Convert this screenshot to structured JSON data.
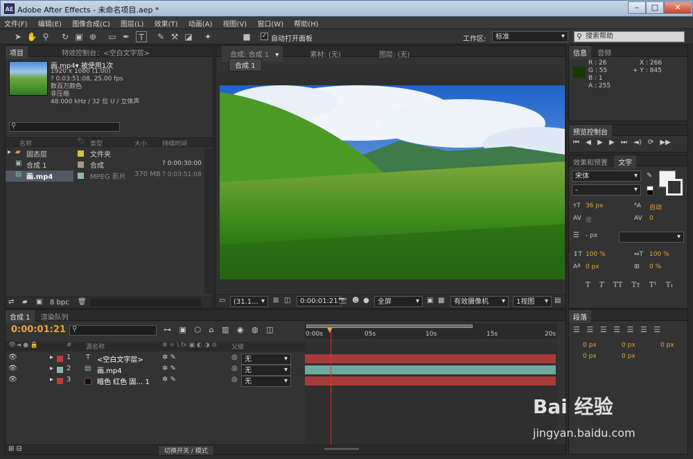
{
  "window": {
    "title": "Adobe After Effects - 未命名项目.aep *",
    "app_icon": "AE",
    "minimize": "–",
    "maximize": "□",
    "close": "✕"
  },
  "menu": [
    "文件(F)",
    "编辑(E)",
    "图像合成(C)",
    "图层(L)",
    "效果(T)",
    "动画(A)",
    "视图(V)",
    "窗口(W)",
    "帮助(H)"
  ],
  "toolbar": {
    "auto_open_label": "自动打开面板",
    "workspace_label": "工作区:",
    "workspace_value": "标准",
    "search_placeholder": "搜索帮助"
  },
  "project_panel": {
    "tab_project": "项目",
    "tab_effects": "特效控制台：<空白文字层>",
    "file_name": "画.mp4▾",
    "usage": "被使用1次",
    "info_lines": [
      "1920 x 1080 (1.00)",
      "? 0:03:51:08, 25.00 fps",
      "数百万颜色",
      "非压缩",
      "48.000 kHz / 32 位 U / 立体声"
    ],
    "columns": [
      "名称",
      "类型",
      "大小",
      "持续时间"
    ],
    "items": [
      {
        "name": "固态层",
        "type": "文件夹",
        "size": "",
        "duration": "",
        "color": "#d9c33a"
      },
      {
        "name": "合成 1",
        "type": "合成",
        "size": "",
        "duration": "? 0:00:30:00",
        "color": "#a89a7a"
      },
      {
        "name": "画.mp4",
        "type": "MPEG 影片",
        "size": "370 MB",
        "duration": "? 0:03:51:08",
        "color": "#8fb7b0"
      }
    ],
    "bpc": "8 bpc"
  },
  "comp_panel": {
    "tab_comp": "合成: 合成 1",
    "tab_footage": "素材: (无)",
    "tab_layer": "图层: (无)",
    "breadcrumb": "合成 1",
    "zoom": "(31.1...",
    "timecode": "0:00:01:21",
    "resolution": "全屏",
    "camera": "有效摄像机",
    "views": "1视图"
  },
  "info_panel": {
    "tab_info": "信息",
    "tab_audio": "音频",
    "r": "R : 26",
    "g": "G : 55",
    "b": "B : 1",
    "a": "A : 255",
    "x": "X : 266",
    "y": "+ Y : 845",
    "swatch": "#1a3701"
  },
  "preview_panel": {
    "tab": "预览控制台"
  },
  "char_panel": {
    "tab_effects": "效果和预置",
    "tab_text": "文字",
    "font": "宋体",
    "style": "-",
    "size": "36",
    "size_unit": "px",
    "leading": "自动",
    "kerning": "度",
    "tracking": "0",
    "stroke": "-",
    "stroke_unit": "px",
    "vscale": "100",
    "hscale": "100",
    "baseline": "0",
    "tsume": "0",
    "pct": "%",
    "px": "px",
    "styles": [
      "T",
      "T",
      "TT",
      "Tт",
      "T¹",
      "T₁"
    ]
  },
  "paragraph_panel": {
    "tab": "段落",
    "values": [
      "0",
      "0",
      "0",
      "0",
      "0"
    ],
    "unit": "px"
  },
  "timeline": {
    "tab_comp": "合成 1",
    "tab_render": "渲染队列",
    "timecode": "0:00:01:21",
    "col_num": "#",
    "col_name": "源名称",
    "col_parent": "父级",
    "ruler": [
      "0:00s",
      "05s",
      "10s",
      "15s",
      "20s"
    ],
    "layers": [
      {
        "num": "1",
        "name": "<空白文字层>",
        "color": "#c03a3a",
        "parent": "无",
        "bar": "#a83a3a"
      },
      {
        "num": "2",
        "name": "画.mp4",
        "color": "#8fb7b0",
        "parent": "无",
        "bar": "#6fa89f"
      },
      {
        "num": "3",
        "name": "暗色 红色 固… 1",
        "color": "#c03a3a",
        "parent": "无",
        "bar": "#a83a3a"
      }
    ],
    "switch_label": "切换开关 / 模式"
  },
  "watermark": {
    "brand": "Bai 经验",
    "url": "jingyan.baidu.com"
  }
}
